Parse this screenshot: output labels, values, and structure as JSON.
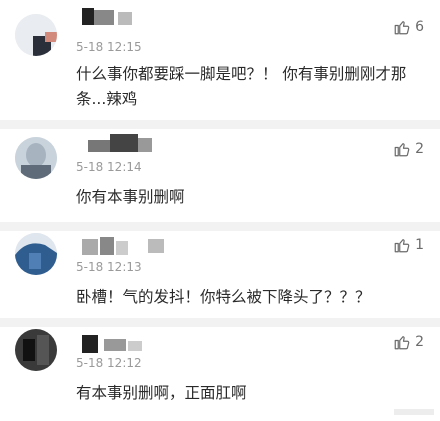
{
  "comments": [
    {
      "timestamp": "5-18 12:15",
      "likes": "6",
      "text": "什么事你都要踩一脚是吧？！ 你有事别删刚才那条...辣鸡"
    },
    {
      "timestamp": "5-18 12:14",
      "likes": "2",
      "text": "你有本事别删啊"
    },
    {
      "timestamp": "5-18 12:13",
      "likes": "1",
      "text": "卧槽！气的发抖！你特么被下降头了？？？"
    },
    {
      "timestamp": "5-18 12:12",
      "likes": "2",
      "text": "有本事别删啊，正面肛啊"
    }
  ],
  "icons": {
    "like": "thumbs-up-icon"
  },
  "colors": {
    "divider": "#f2f2f2",
    "meta_text": "#9a9a9a",
    "body_text": "#2a2a2a"
  }
}
